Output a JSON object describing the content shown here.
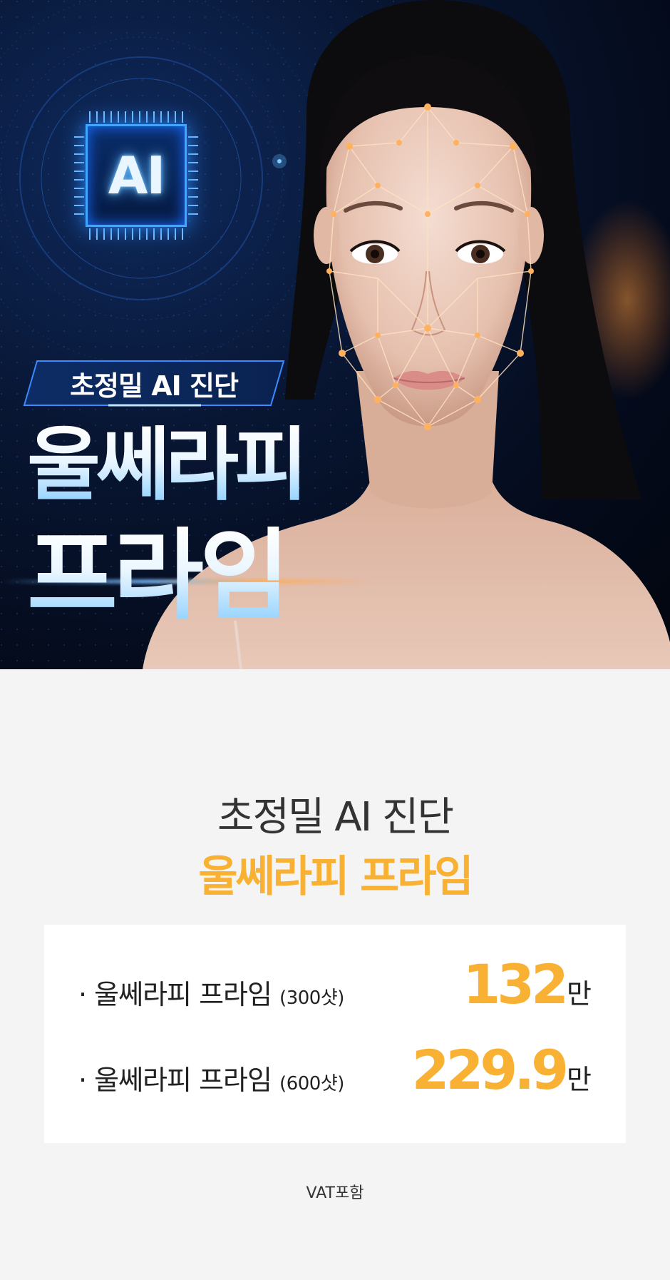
{
  "hero": {
    "chip_label": "AI",
    "badge": "초정밀 AI 진단",
    "title_line1": "울쎄라피",
    "title_line2": "프라임"
  },
  "info": {
    "subtitle": "초정밀 AI 진단",
    "title": "울쎄라피 프라임",
    "accent_color": "#f8b133",
    "items": [
      {
        "name": "· 울쎄라피 프라임 ",
        "detail": "(300샷)",
        "price": "132",
        "unit": "만"
      },
      {
        "name": "· 울쎄라피 프라임 ",
        "detail": "(600샷)",
        "price": "229.9",
        "unit": "만"
      }
    ],
    "footnote": "VAT포함"
  }
}
